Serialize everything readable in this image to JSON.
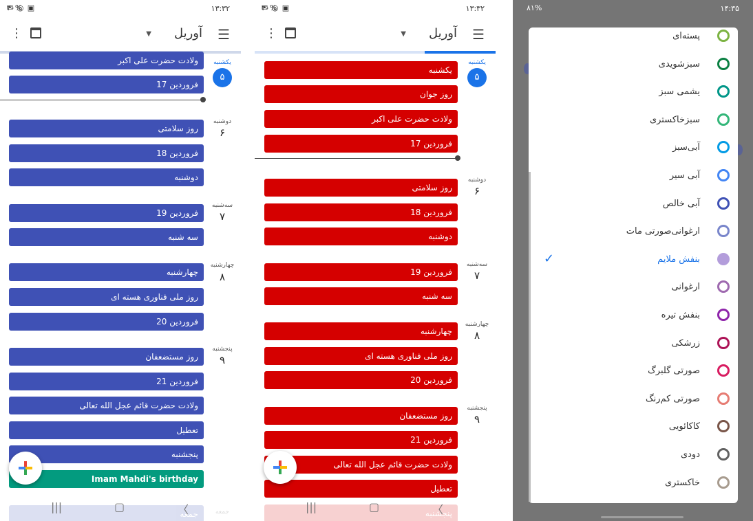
{
  "panel1": {
    "status": {
      "time": "۱۳:۳۲",
      "battery": "۳۰%"
    },
    "appbar": {
      "month": "آوریل"
    },
    "days": [
      {
        "name": "یکشنبه",
        "num": "۵",
        "today": true
      },
      {
        "name": "دوشنبه",
        "num": "۶"
      },
      {
        "name": "سه‌شنبه",
        "num": "۷"
      },
      {
        "name": "چهارشنبه",
        "num": "۸"
      },
      {
        "name": "پنجشنبه",
        "num": "۹"
      },
      {
        "name": "جمعه",
        "num": "۱۰"
      }
    ],
    "events": [
      "ولادت حضرت علی اکبر",
      "17 فروردین",
      "روز سلامتی",
      "18 فروردین",
      "دوشنبه",
      "19 فروردین",
      "سه شنبه",
      "چهارشنبه",
      "روز ملی فناوری هسته ای",
      "20 فروردین",
      "روز مستضعفان",
      "21 فروردین",
      "ولادت حضرت قائم عجل الله تعالی",
      "تعطیل",
      "پنجشنبه",
      "Imam Mahdi's birthday",
      "جمعه"
    ]
  },
  "panel2": {
    "status": {
      "time": "۱۳:۳۲",
      "battery": "۳۰%"
    },
    "appbar": {
      "month": "آوریل"
    },
    "days": [
      {
        "name": "یکشنبه",
        "num": "۵",
        "today": true
      },
      {
        "name": "دوشنبه",
        "num": "۶"
      },
      {
        "name": "سه‌شنبه",
        "num": "۷"
      },
      {
        "name": "چهارشنبه",
        "num": "۸"
      },
      {
        "name": "پنجشنبه",
        "num": "۹"
      }
    ],
    "events": [
      "یکشنبه",
      "روز جوان",
      "ولادت حضرت علی اکبر",
      "17 فروردین",
      "روز سلامتی",
      "18 فروردین",
      "دوشنبه",
      "19 فروردین",
      "سه شنبه",
      "چهارشنبه",
      "روز ملی فناوری هسته ای",
      "20 فروردین",
      "روز مستضعفان",
      "21 فروردین",
      "ولادت حضرت قائم عجل الله تعالی",
      "تعطیل",
      "پنجشنبه"
    ]
  },
  "panel3": {
    "status": {
      "time": "۱۴:۳۵",
      "battery": "۸۱%"
    },
    "colors": [
      {
        "label": "پسته‌ای",
        "color": "#7cb342"
      },
      {
        "label": "سبزشویدی",
        "color": "#0b8043"
      },
      {
        "label": "یشمی سبز",
        "color": "#009688"
      },
      {
        "label": "سبزخاکستری",
        "color": "#33b679"
      },
      {
        "label": "آبی‌سبز",
        "color": "#039be5"
      },
      {
        "label": "آبی سیر",
        "color": "#4285f4"
      },
      {
        "label": "آبی خالص",
        "color": "#3f51b5"
      },
      {
        "label": "ارغوانی‌صورتی مات",
        "color": "#7986cb"
      },
      {
        "label": "بنفش ملایم",
        "color": "#b39ddb",
        "selected": true
      },
      {
        "label": "ارغوانی",
        "color": "#9e69af"
      },
      {
        "label": "بنفش تیره",
        "color": "#8e24aa"
      },
      {
        "label": "زرشکی",
        "color": "#ad1457"
      },
      {
        "label": "صورتی گلبرگ",
        "color": "#d81b60"
      },
      {
        "label": "صورتی کم‌رنگ",
        "color": "#e67c73"
      },
      {
        "label": "کاکائویی",
        "color": "#795548"
      },
      {
        "label": "دودی",
        "color": "#616161"
      },
      {
        "label": "خاکستری",
        "color": "#a79b8e"
      }
    ]
  },
  "colors": {
    "accent": "#1a73e8",
    "event_blue": "#3f51b5",
    "event_red": "#d50000",
    "event_teal": "#039b7f"
  },
  "icons": {
    "menu": "hamburger-icon",
    "calendar": "calendar-icon",
    "more": "more-vert-icon",
    "check": "check-icon"
  }
}
